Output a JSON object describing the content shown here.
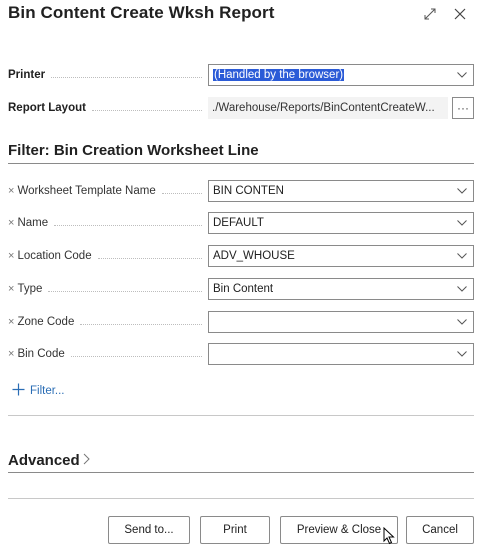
{
  "dialog": {
    "title": "Bin Content Create Wksh Report"
  },
  "options": {
    "printer_label": "Printer",
    "printer_value": "(Handled by the browser)",
    "layout_label": "Report Layout",
    "layout_value": "./Warehouse/Reports/BinContentCreateW...",
    "layout_more": "···"
  },
  "filter": {
    "section_title": "Filter: Bin Creation Worksheet Line",
    "remove_icon": "×",
    "fields": [
      {
        "label": "Worksheet Template Name",
        "value": "BIN CONTEN"
      },
      {
        "label": "Name",
        "value": "DEFAULT"
      },
      {
        "label": "Location Code",
        "value": "ADV_WHOUSE"
      },
      {
        "label": "Type",
        "value": "Bin Content"
      },
      {
        "label": "Zone Code",
        "value": ""
      },
      {
        "label": "Bin Code",
        "value": ""
      }
    ],
    "add_filter_label": "Filter..."
  },
  "advanced": {
    "label": "Advanced",
    "chevron": "›"
  },
  "buttons": {
    "send_to": "Send to...",
    "print": "Print",
    "preview_close": "Preview & Close",
    "cancel": "Cancel"
  },
  "icons": {
    "expand": "expand-icon",
    "close": "close-icon",
    "chevron": "chevron-down-icon",
    "plus": "plus-icon",
    "cursor": "mouse-pointer-icon"
  },
  "colors": {
    "selection": "#2b5bd7",
    "link": "#2a6db5",
    "border": "#8a8a8a"
  }
}
